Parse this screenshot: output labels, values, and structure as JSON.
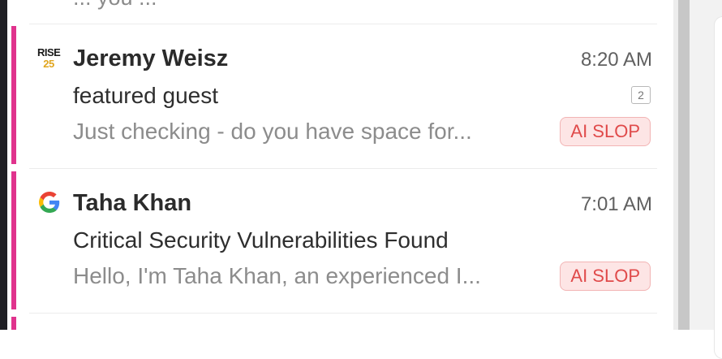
{
  "previous_email": {
    "snippet": "... you ..."
  },
  "emails": [
    {
      "sender": "Jeremy Weisz",
      "logo_text_line1": "RISE",
      "logo_text_line2": "25",
      "time": "8:20 AM",
      "subject": "featured guest",
      "snippet": "Just checking - do you have space for...",
      "thread_count": "2",
      "tag": "AI SLOP"
    },
    {
      "sender": "Taha Khan",
      "icon": "google-icon",
      "time": "7:01 AM",
      "subject": "Critical Security Vulnerabilities Found",
      "snippet": "Hello, I'm Taha Khan, an experienced I...",
      "tag": "AI SLOP"
    }
  ],
  "colors": {
    "accent": "#e0338d",
    "tag_bg": "#fde5e5",
    "tag_text": "#e04a4a"
  }
}
